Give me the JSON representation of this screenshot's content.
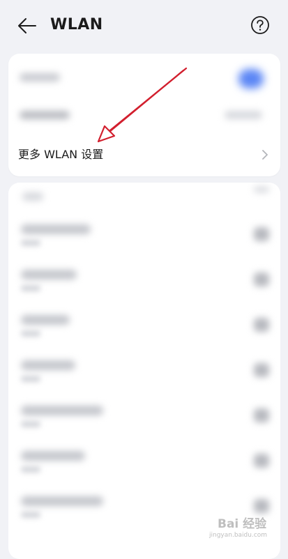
{
  "header": {
    "title": "WLAN",
    "back_icon": "arrow-left-icon",
    "help_icon": "help-circle-icon"
  },
  "settings_card": {
    "more_label": "更多 WLAN 设置",
    "chevron_icon": "chevron-right-icon",
    "toggle_color": "#5b86f5"
  },
  "watermark": {
    "text": "Bai 经验",
    "sub": "jingyan.baidu.com"
  },
  "colors": {
    "background": "#f1f2f6",
    "card": "#ffffff",
    "arrow": "#d21f2e"
  }
}
